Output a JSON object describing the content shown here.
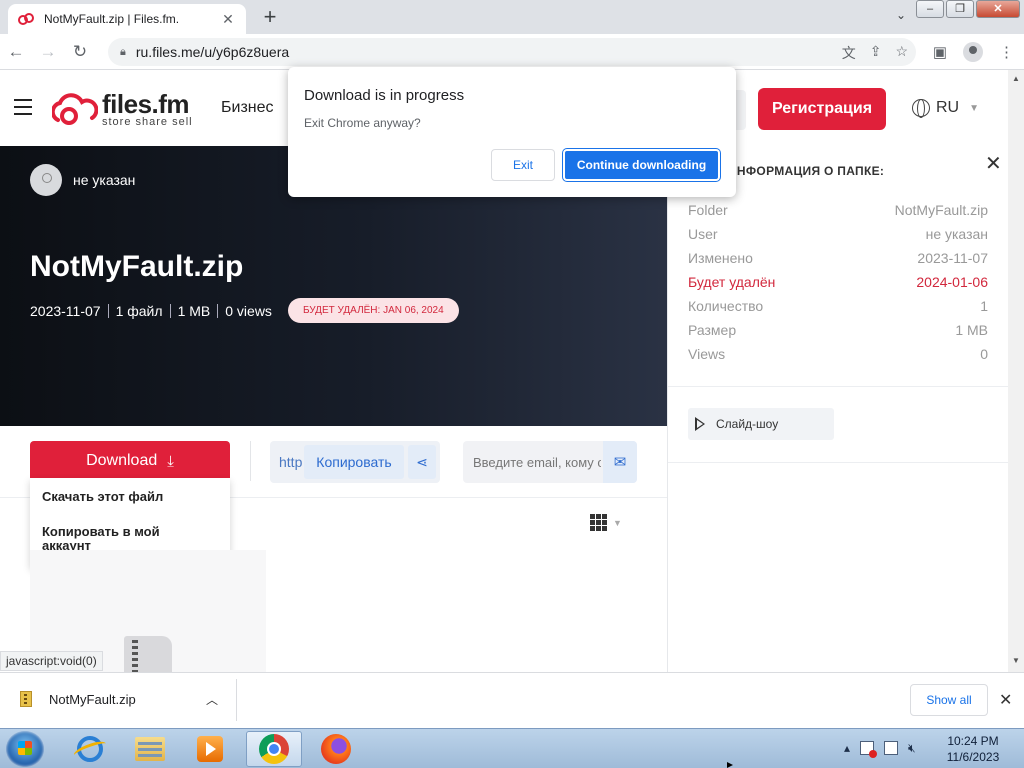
{
  "browser": {
    "tab_title": "NotMyFault.zip | Files.fm.",
    "url": "ru.files.me/u/y6p6z8uera",
    "status_tip": "javascript:void(0)"
  },
  "site": {
    "logo_name": "files.fm",
    "logo_tagline": "store share sell",
    "nav_business": "Бизнес",
    "register_label": "Регистрация",
    "language": "RU",
    "accent_color": "#e0203a"
  },
  "hero": {
    "username": "не указан",
    "file_title": "NotMyFault.zip",
    "date": "2023-11-07",
    "files": "1 файл",
    "size": "1 MB",
    "views": "0 views",
    "delete_badge": "БУДЕТ УДАЛЁН: JAN 06, 2024"
  },
  "actions": {
    "download_label": "Download",
    "link_prefix": "http",
    "copy_label": "Копировать",
    "email_placeholder": "Введите email, кому отправить",
    "dropdown": [
      "Скачать этот файл",
      "Копировать в мой аккаунт"
    ]
  },
  "side_panel": {
    "heading": "ИНФОРМАЦИЯ О ПАПКЕ:",
    "rows": [
      {
        "label": "Folder",
        "value": "NotMyFault.zip"
      },
      {
        "label": "User",
        "value": "не указан"
      },
      {
        "label": "Изменено",
        "value": "2023-11-07"
      },
      {
        "label": "Будет удалён",
        "value": "2024-01-06"
      },
      {
        "label": "Количество",
        "value": "1"
      },
      {
        "label": "Размер",
        "value": "1 MB"
      },
      {
        "label": "Views",
        "value": "0"
      }
    ],
    "slideshow_label": "Слайд-шоу"
  },
  "dialog": {
    "title": "Download is in progress",
    "message": "Exit Chrome anyway?",
    "exit_label": "Exit",
    "continue_label": "Continue downloading"
  },
  "download_shelf": {
    "filename": "NotMyFault.zip",
    "show_all_label": "Show all"
  },
  "taskbar": {
    "time": "10:24 PM",
    "date": "11/6/2023",
    "apps": [
      "internet-explorer",
      "file-explorer",
      "media-player",
      "chrome",
      "firefox"
    ]
  }
}
